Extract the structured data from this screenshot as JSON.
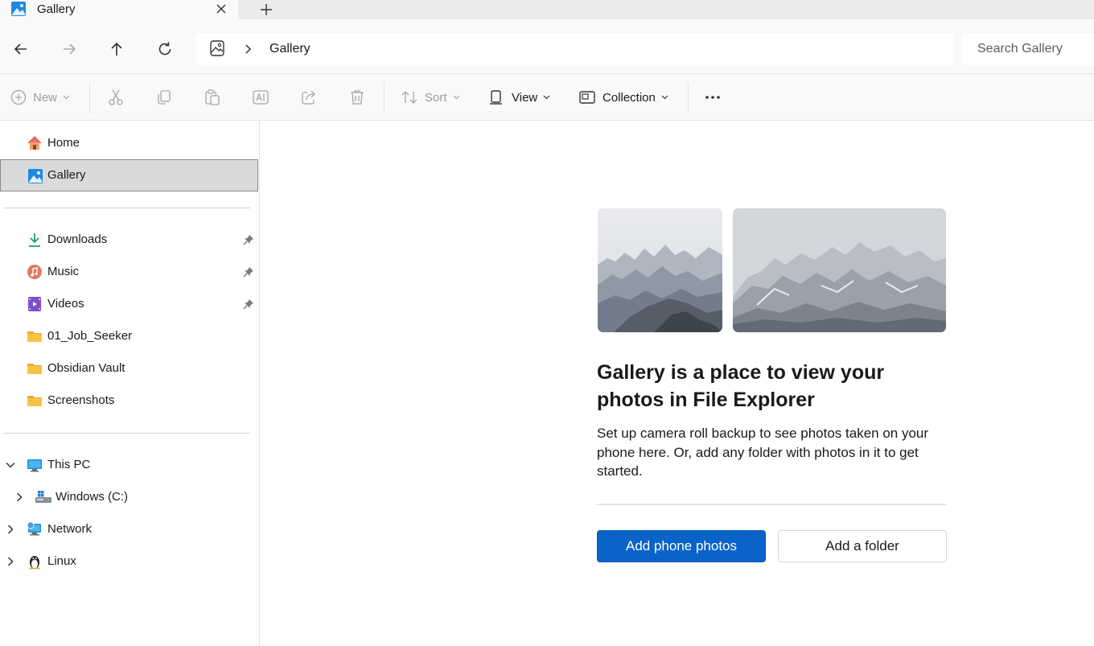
{
  "tab": {
    "title": "Gallery",
    "icon": "gallery-icon"
  },
  "address": {
    "crumb": "Gallery"
  },
  "search": {
    "placeholder": "Search Gallery"
  },
  "toolbar": {
    "new_label": "New",
    "sort_label": "Sort",
    "view_label": "View",
    "collection_label": "Collection"
  },
  "sidebar": {
    "items": [
      {
        "label": "Home",
        "icon": "home-icon"
      },
      {
        "label": "Gallery",
        "icon": "gallery-icon"
      },
      {
        "label": "Downloads",
        "icon": "download-icon",
        "pinned": true
      },
      {
        "label": "Music",
        "icon": "music-icon",
        "pinned": true
      },
      {
        "label": "Videos",
        "icon": "video-icon",
        "pinned": true
      },
      {
        "label": "01_Job_Seeker",
        "icon": "folder-icon"
      },
      {
        "label": "Obsidian Vault",
        "icon": "folder-icon"
      },
      {
        "label": "Screenshots",
        "icon": "folder-icon"
      },
      {
        "label": "This PC",
        "icon": "pc-icon"
      },
      {
        "label": "Windows (C:)",
        "icon": "drive-icon"
      },
      {
        "label": "Network",
        "icon": "network-icon"
      },
      {
        "label": "Linux",
        "icon": "linux-icon"
      }
    ]
  },
  "main": {
    "headline": "Gallery is a place to view your photos in File Explorer",
    "description": "Set up camera roll backup to see photos taken on your phone here. Or, add any folder with photos in it to get started.",
    "primary_button": "Add phone photos",
    "secondary_button": "Add a folder"
  },
  "colors": {
    "accent": "#0a63c9",
    "selected_bg": "#dadada",
    "folder": "#f6c445"
  }
}
